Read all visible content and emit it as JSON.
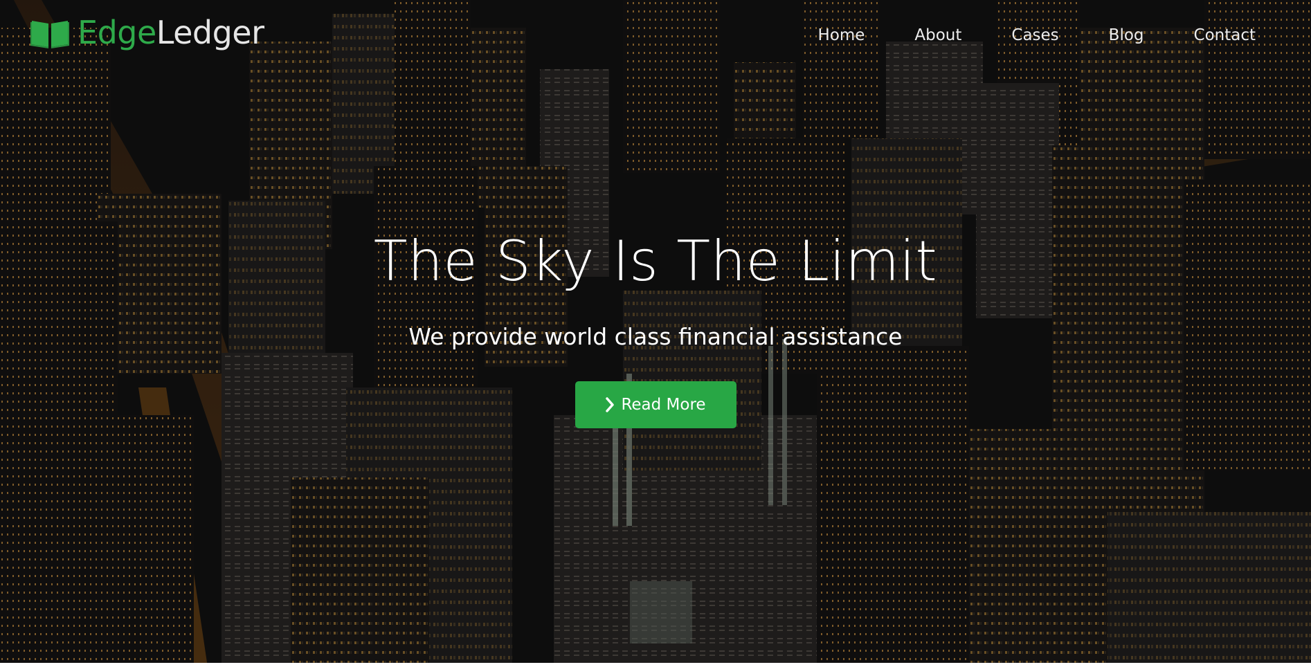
{
  "brand": {
    "name_part1": "Edge",
    "name_part2": "Ledger",
    "icon": "open-book-icon",
    "color_accent": "#2eaa4a"
  },
  "nav": {
    "items": [
      {
        "label": "Home"
      },
      {
        "label": "About"
      },
      {
        "label": "Cases"
      },
      {
        "label": "Blog"
      },
      {
        "label": "Contact"
      }
    ]
  },
  "hero": {
    "title": "The Sky Is The Limit",
    "subtitle": "We provide world class financial assistance",
    "cta_label": "Read More",
    "cta_icon": "chevron-right-icon",
    "cta_color": "#28a745",
    "background": "night-city-aerial-photo"
  }
}
